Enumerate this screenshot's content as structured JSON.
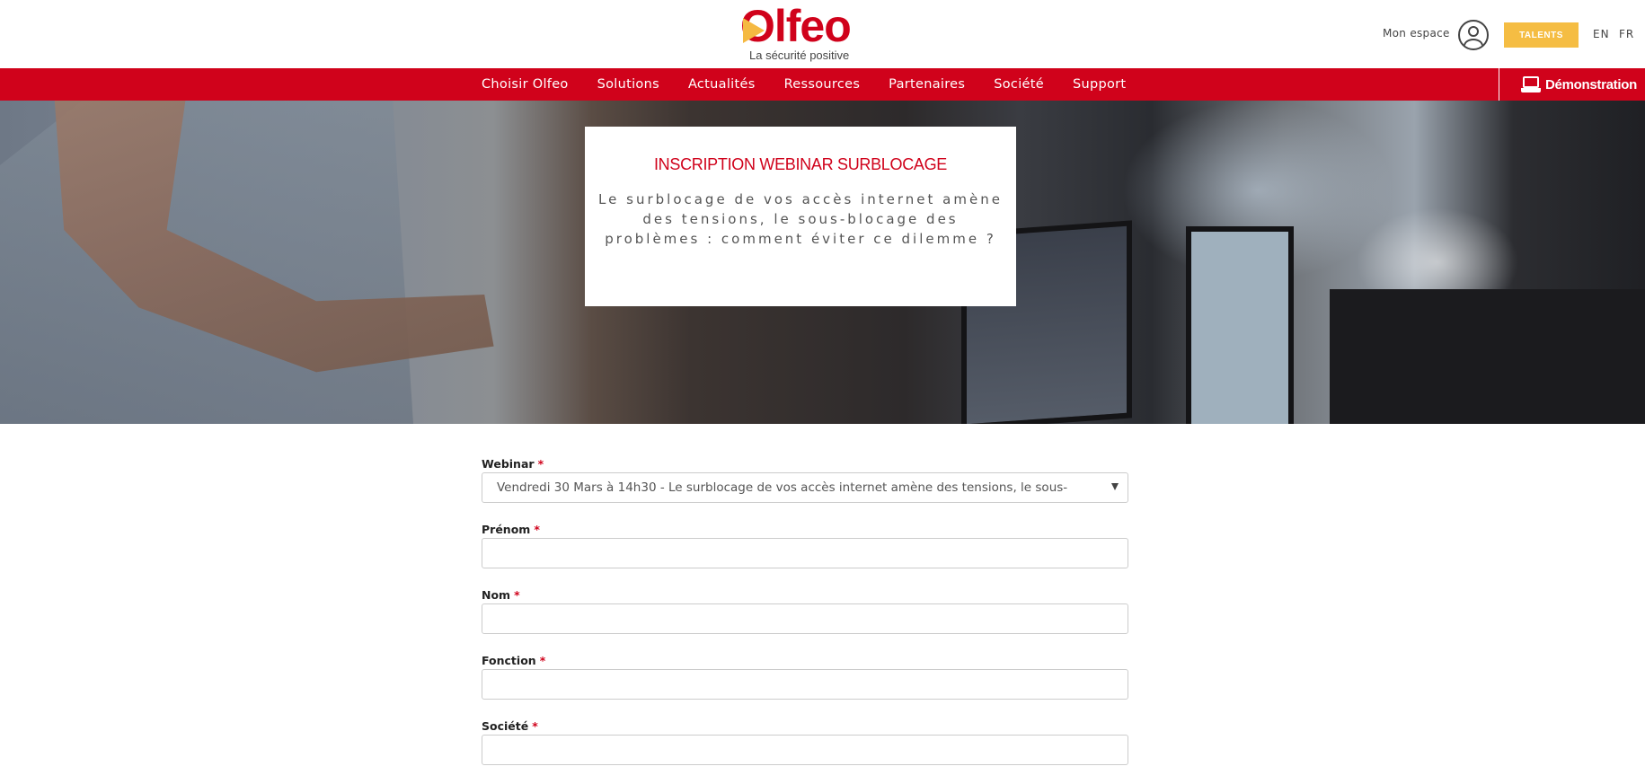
{
  "brand": {
    "name": "Olfeo",
    "tagline": "La sécurité positive",
    "colors": {
      "primary": "#d0021b",
      "accent": "#f5bd43"
    }
  },
  "header": {
    "account_label": "Mon espace",
    "account_icon": "user-icon",
    "talents_label": "TALENTS",
    "languages": [
      "EN",
      "FR"
    ]
  },
  "nav": {
    "items": [
      {
        "label": "Choisir Olfeo"
      },
      {
        "label": "Solutions"
      },
      {
        "label": "Actualités"
      },
      {
        "label": "Ressources"
      },
      {
        "label": "Partenaires"
      },
      {
        "label": "Société"
      },
      {
        "label": "Support"
      }
    ],
    "demo_label": "Démonstration",
    "demo_icon": "laptop-icon"
  },
  "hero": {
    "title": "INSCRIPTION WEBINAR SURBLOCAGE",
    "subtitle": "Le surblocage de vos accès internet amène des tensions, le sous-blocage des problèmes : comment éviter ce dilemme ?"
  },
  "form": {
    "required_marker": "*",
    "fields": [
      {
        "label": "Webinar",
        "type": "select",
        "value": "Vendredi 30 Mars à 14h30 - Le surblocage de vos accès internet amène des tensions, le sous-"
      },
      {
        "label": "Prénom",
        "type": "text",
        "value": ""
      },
      {
        "label": "Nom",
        "type": "text",
        "value": ""
      },
      {
        "label": "Fonction",
        "type": "text",
        "value": ""
      },
      {
        "label": "Société",
        "type": "text",
        "value": ""
      }
    ]
  }
}
